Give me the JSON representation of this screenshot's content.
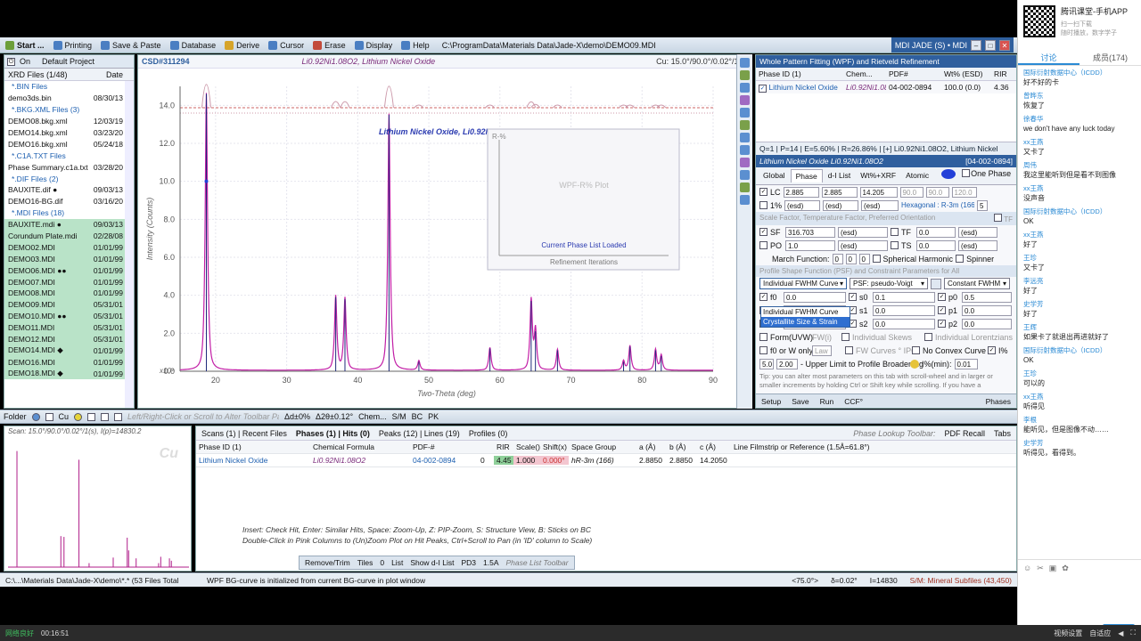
{
  "menubar": {
    "items": [
      {
        "label": "Start ...",
        "icon": "start-icon"
      },
      {
        "label": "Printing",
        "icon": "printer-icon"
      },
      {
        "label": "Save & Paste",
        "icon": "save-icon"
      },
      {
        "label": "Database",
        "icon": "database-icon"
      },
      {
        "label": "Derive",
        "icon": "derive-icon"
      },
      {
        "label": "Cursor",
        "icon": "cursor-icon"
      },
      {
        "label": "Erase",
        "icon": "erase-icon"
      },
      {
        "label": "Display",
        "icon": "display-icon"
      },
      {
        "label": "Help",
        "icon": "help-icon"
      }
    ],
    "path": "C:\\ProgramData\\Materials Data\\Jade-X\\demo\\DEMO09.MDI",
    "app_title": "MDI JADE (S) • MDI"
  },
  "left_panel": {
    "on_label": "On",
    "project": "Default Project",
    "col_files": "XRD Files (1/48)",
    "col_date": "Date",
    "rows": [
      {
        "type": "grp",
        "name": ".BIN Files",
        "date": ""
      },
      {
        "type": "file",
        "name": "demo3ds.bin",
        "date": "08/30/13"
      },
      {
        "type": "grp",
        "name": ".BKG.XML Files (3)",
        "date": ""
      },
      {
        "type": "file",
        "name": "DEMO08.bkg.xml",
        "date": "12/03/19"
      },
      {
        "type": "file",
        "name": "DEMO14.bkg.xml",
        "date": "03/23/20"
      },
      {
        "type": "file",
        "name": "DEMO16.bkg.xml",
        "date": "05/24/18"
      },
      {
        "type": "grp",
        "name": ".C1A.TXT Files",
        "date": ""
      },
      {
        "type": "file",
        "name": "Phase Summary.c1a.txt",
        "date": "03/28/20"
      },
      {
        "type": "grp",
        "name": ".DIF Files (2)",
        "date": ""
      },
      {
        "type": "file",
        "name": "BAUXITE.dif ●",
        "date": "09/03/13"
      },
      {
        "type": "file",
        "name": "DEMO16-BG.dif",
        "date": "03/16/20"
      },
      {
        "type": "grp",
        "name": ".MDI Files (18)",
        "date": ""
      },
      {
        "type": "file",
        "name": "BAUXITE.mdi ●",
        "date": "09/03/13"
      },
      {
        "type": "file",
        "name": "Corundum Plate.mdi",
        "date": "02/28/08"
      },
      {
        "type": "file",
        "name": "DEMO02.MDI",
        "date": "01/01/99"
      },
      {
        "type": "file",
        "name": "DEMO03.MDI",
        "date": "01/01/99"
      },
      {
        "type": "file",
        "name": "DEMO06.MDI ●●",
        "date": "01/01/99"
      },
      {
        "type": "file",
        "name": "DEMO07.MDI",
        "date": "01/01/99"
      },
      {
        "type": "file",
        "name": "DEMO08.MDI",
        "date": "01/01/99"
      },
      {
        "type": "sel",
        "name": "DEMO09.MDI",
        "date": "05/31/01"
      },
      {
        "type": "file",
        "name": "DEMO10.MDI ●●",
        "date": "05/31/01"
      },
      {
        "type": "file",
        "name": "DEMO11.MDI",
        "date": "05/31/01"
      },
      {
        "type": "file",
        "name": "DEMO12.MDI",
        "date": "05/31/01"
      },
      {
        "type": "file",
        "name": "DEMO14.MDI ◆",
        "date": "01/01/99"
      },
      {
        "type": "file",
        "name": "DEMO16.MDI",
        "date": "01/01/99"
      },
      {
        "type": "file",
        "name": "DEMO18.MDI ◆",
        "date": "01/01/99"
      }
    ]
  },
  "plot": {
    "csd": "CSD#311294",
    "header_title": "Li0.92Ni1.08O2, Lithium Nickel Oxide",
    "cu_label": "Cu: 15.0°/90.0°/0.02°/1(s)",
    "phase_label": "Lithium Nickel Oxide, Li0.92Ni1.08O2",
    "x10_label": "x10³",
    "inset": {
      "ylabel": "R-%",
      "center": "WPF-R% Plot",
      "status": "Current Phase List Loaded",
      "xlabel": "Refinement Iterations"
    }
  },
  "chart_data": {
    "type": "line",
    "xlabel": "Two-Theta (deg)",
    "ylabel": "Intensity (Counts)",
    "xlim": [
      15,
      90
    ],
    "ylim": [
      0,
      15
    ],
    "xticks": [
      20,
      30,
      40,
      50,
      60,
      70,
      80,
      90
    ],
    "yticks": [
      0,
      2.0,
      4.0,
      6.0,
      8.0,
      10.0,
      12.0,
      14.0
    ],
    "peaks": [
      {
        "x": 18.7,
        "y": 14.6
      },
      {
        "x": 36.9,
        "y": 3.9
      },
      {
        "x": 38.2,
        "y": 3.8
      },
      {
        "x": 44.4,
        "y": 13.5
      },
      {
        "x": 48.6,
        "y": 0.5
      },
      {
        "x": 58.6,
        "y": 1.2
      },
      {
        "x": 64.4,
        "y": 3.7
      },
      {
        "x": 65.0,
        "y": 2.1
      },
      {
        "x": 68.1,
        "y": 1.1
      },
      {
        "x": 77.4,
        "y": 0.5
      },
      {
        "x": 78.3,
        "y": 1.3
      },
      {
        "x": 81.9,
        "y": 1.1
      },
      {
        "x": 82.7,
        "y": 0.8
      }
    ],
    "grid": true
  },
  "right_panel": {
    "title": "Whole Pattern Fitting (WPF) and Rietveld Refinement",
    "cols": [
      "Phase ID (1)",
      "Chem...",
      "PDF#",
      "Wt% (ESD)",
      "RIR"
    ],
    "phase_row": {
      "name": "Lithium Nickel Oxide",
      "formula": "Li0.92Ni1.08O2",
      "pdf": "04-002-0894",
      "wt": "100.0 (0.0)",
      "rir": "4.36"
    },
    "stats": "Q=1 | P=14 | E=5.60% | R=26.86% | [+] Li0.92Ni1.08O2, Lithium Nickel",
    "phase_header": "Lithium Nickel Oxide Li0.92Ni1.08O2",
    "phase_pdf": "[04-002-0894]",
    "tabs": [
      "Global",
      "Phase",
      "d-I List",
      "Wt%+XRF",
      "Atomic"
    ],
    "one_phase": "One Phase",
    "lc": {
      "label": "LC",
      "a": "2.885",
      "b": "2.885",
      "c": "14.205",
      "alpha": "90.0",
      "beta": "90.0",
      "gamma": "120.0"
    },
    "pct": {
      "label": "1%",
      "esd1": "(esd)",
      "esd2": "(esd)",
      "esd3": "(esd)",
      "sg": "Hexagonal : R-3m (166) ● 1/...",
      "val": "5"
    },
    "scale_sec": "Scale Factor, Temperature Factor, Preferred Orientation",
    "tf_label": "TF",
    "sf": {
      "label": "SF",
      "value": "316.703",
      "esd": "(esd)",
      "tf": "TF",
      "tf_val": "0.0",
      "tf_esd": "(esd)"
    },
    "po": {
      "label": "PO",
      "value": "1.0",
      "esd": "(esd)",
      "ts": "TS",
      "ts_val": "0.0",
      "ts_esd": "(esd)"
    },
    "march": {
      "label": "March Function:",
      "v1": "0",
      "v2": "0",
      "v3": "0",
      "sh": "Spherical Harmonic",
      "spinner": "Spinner"
    },
    "psf_sec": "Profile Shape Function (PSF) and Constraint Parameters for All",
    "dropdown": {
      "selected": "Individual FWHM Curve",
      "options": [
        "Individual FWHM Curve",
        "Crystallite Size & Strain"
      ]
    },
    "psf_sel": "PSF: pseudo-Voigt",
    "fwhm_sel": "Constant FWHM",
    "params": [
      {
        "l": "f0",
        "v": "0.0",
        "sl": "s0",
        "sv": "0.1",
        "pl": "p0",
        "pv": "0.5"
      },
      {
        "l": "f1",
        "v": "0.0",
        "sl": "s1",
        "sv": "0.0",
        "pl": "p1",
        "pv": "0.0"
      },
      {
        "l": "f2",
        "v": "0.0",
        "sl": "s2",
        "sv": "0.0",
        "pl": "p2",
        "pv": "0.0"
      }
    ],
    "form_uvw": "Form(UVW)",
    "fw_label": "FW(i)",
    "skews": "Individual Skews",
    "lorentz": "Individual Lorentzians",
    "f0_only": "f0 or W only",
    "law": "Law",
    "fw_curves": "FW Curves ° IPC",
    "noconvex": "No Convex Curve",
    "i_pct": "I%",
    "limit_v1": "5.0",
    "limit_v2": "2.00",
    "limit_label": "- Upper Limit to Profile Broadening",
    "imin_label": "I%(min):",
    "imin_val": "0.01",
    "tip": "Tip: you can alter most parameters on this tab with scroll-wheel and in larger or smaller increments by holding Ctrl or Shift key while scrolling. If you have a",
    "bottom_bar": [
      "Setup",
      "Save",
      "Run",
      "CCF°",
      "Phases"
    ]
  },
  "midtool": {
    "folder": "Folder",
    "cu": "Cu",
    "hint": "Left/Right-Click or Scroll to Alter Toolbar Parameter",
    "d_theta": "Δd±0%",
    "d2theta": "Δ2θ±0.12°",
    "chem": "Chem...",
    "sm": "S/M",
    "bc": "BC",
    "pk": "PK"
  },
  "scan": {
    "label": "Scan: 15.0°/90.0°/0.02°/1(s), I(p)=14830.2",
    "watermark": "Cu"
  },
  "lower": {
    "tabs": [
      "Scans (1) | Recent Files",
      "Phases (1) | Hits (0)",
      "Peaks (12) | Lines (19)",
      "Profiles (0)"
    ],
    "toolbar_label": "Phase Lookup Toolbar:",
    "pdf_recall": "PDF Recall",
    "tabs_label": "Tabs",
    "cols": [
      "Phase ID (1)",
      "Chemical Formula",
      "PDF-#",
      "",
      "",
      "RIR",
      "Scale()",
      "Shift(x)",
      "Space Group",
      "",
      "a (Å)",
      "b (Å)",
      "c (Å)",
      "Line Filmstrip or Reference (1.5Å=61.8°)"
    ],
    "row": [
      "Lithium Nickel Oxide",
      "Li0.92Ni1.08O2",
      "04-002-0894",
      "",
      "0",
      "4.45",
      "1.000",
      "0.000°",
      "hR-3m (166)",
      "",
      "2.8850",
      "2.8850",
      "14.2050",
      ""
    ],
    "hint1": "Insert: Check Hit, Enter: Similar Hits, Space: Zoom-Up, Z: PIP-Zoom, S: Structure View, B: Sticks on BC",
    "hint2": "Double-Click in Pink Columns to (Un)Zoom Plot on Hit Peaks, Ctrl+Scroll to Pan (in 'ID' column to Scale)",
    "bar": [
      "Remove/Trim",
      "Tiles",
      "0",
      "List",
      "Show d-I List",
      "PD3",
      "1.5A",
      "Phase List Toolbar"
    ]
  },
  "status": {
    "path": "C:\\...\\Materials Data\\Jade-X\\demo\\*.* (53 Files Total",
    "msg": "WPF BG-curve is initialized from current BG-curve in plot window",
    "coords": "<75.0°>",
    "delta": "δ=0.02°",
    "intensity": "I=14830",
    "sm": "S/M: Mineral Subfiles (43,450)"
  },
  "chat": {
    "header_title": "腾讯课堂-手机APP",
    "header_sub": "扫一扫下载",
    "header_sub2": "随时播放，数字学子",
    "tabs": [
      "讨论",
      "成员(174)"
    ],
    "messages": [
      {
        "n": "国际衍射数据中心（ICDD）",
        "t": "好不好的卡"
      },
      {
        "n": "曾晔东",
        "t": "恢复了"
      },
      {
        "n": "徐春华",
        "t": "we don't have any luck today"
      },
      {
        "n": "xx王燕",
        "t": "又卡了"
      },
      {
        "n": "周伟",
        "t": "我这里能听到但是看不到图像"
      },
      {
        "n": "xx王燕",
        "t": "没声音"
      },
      {
        "n": "国际衍射数据中心（ICDD）",
        "t": "OK"
      },
      {
        "n": "xx王燕",
        "t": "好了"
      },
      {
        "n": "王珍",
        "t": "又卡了"
      },
      {
        "n": "李远亮",
        "t": "好了"
      },
      {
        "n": "史学芳",
        "t": "好了"
      },
      {
        "n": "王辉",
        "t": "如果卡了就退出再进就好了"
      },
      {
        "n": "国际衍射数据中心（ICDD）",
        "t": "OK"
      },
      {
        "n": "王珍",
        "t": "可以的"
      },
      {
        "n": "xx王燕",
        "t": "听得见"
      },
      {
        "n": "李根",
        "t": "能听见，但是图像不动……"
      },
      {
        "n": "史学芳",
        "t": "听得见，看得到。"
      }
    ],
    "send": "发送"
  },
  "player": {
    "network": "网络良好",
    "time": "00:16:51",
    "ctrl1": "视频设置",
    "ctrl2": "自适应"
  }
}
